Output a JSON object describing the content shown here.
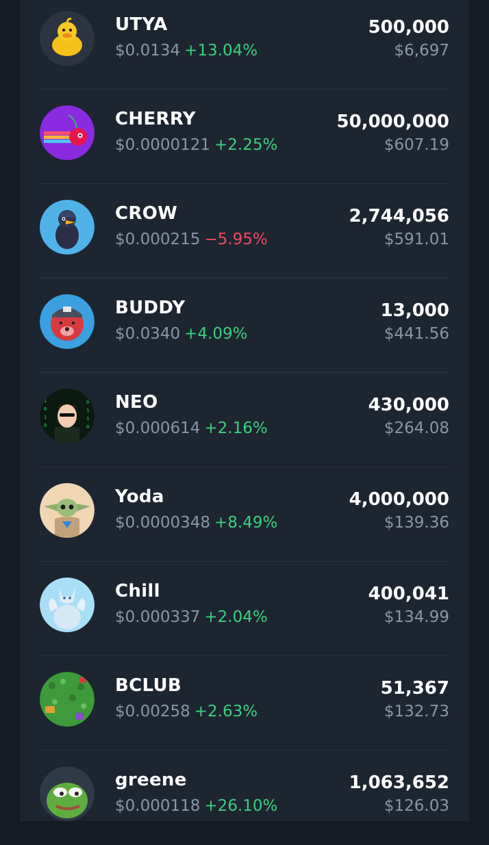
{
  "tokens": [
    {
      "name": "UTYA",
      "price": "$0.0134",
      "change": "+13.04%",
      "direction": "up",
      "amount": "500,000",
      "value": "$6,697",
      "icon": "duck-icon"
    },
    {
      "name": "CHERRY",
      "price": "$0.0000121",
      "change": "+2.25%",
      "direction": "up",
      "amount": "50,000,000",
      "value": "$607.19",
      "icon": "cherry-icon"
    },
    {
      "name": "CROW",
      "price": "$0.000215",
      "change": "−5.95%",
      "direction": "down",
      "amount": "2,744,056",
      "value": "$591.01",
      "icon": "crow-icon"
    },
    {
      "name": "BUDDY",
      "price": "$0.0340",
      "change": "+4.09%",
      "direction": "up",
      "amount": "13,000",
      "value": "$441.56",
      "icon": "bear-icon"
    },
    {
      "name": "NEO",
      "price": "$0.000614",
      "change": "+2.16%",
      "direction": "up",
      "amount": "430,000",
      "value": "$264.08",
      "icon": "neo-icon"
    },
    {
      "name": "Yoda",
      "price": "$0.0000348",
      "change": "+8.49%",
      "direction": "up",
      "amount": "4,000,000",
      "value": "$139.36",
      "icon": "yoda-icon"
    },
    {
      "name": "Chill",
      "price": "$0.000337",
      "change": "+2.04%",
      "direction": "up",
      "amount": "400,041",
      "value": "$134.99",
      "icon": "wolf-icon"
    },
    {
      "name": "BCLUB",
      "price": "$0.00258",
      "change": "+2.63%",
      "direction": "up",
      "amount": "51,367",
      "value": "$132.73",
      "icon": "bclub-icon"
    },
    {
      "name": "greene",
      "price": "$0.000118",
      "change": "+26.10%",
      "direction": "up",
      "amount": "1,063,652",
      "value": "$126.03",
      "icon": "pepe-icon"
    }
  ],
  "colors": {
    "positive": "#3ad07e",
    "negative": "#ef4a5f",
    "muted": "#8a96a6"
  }
}
